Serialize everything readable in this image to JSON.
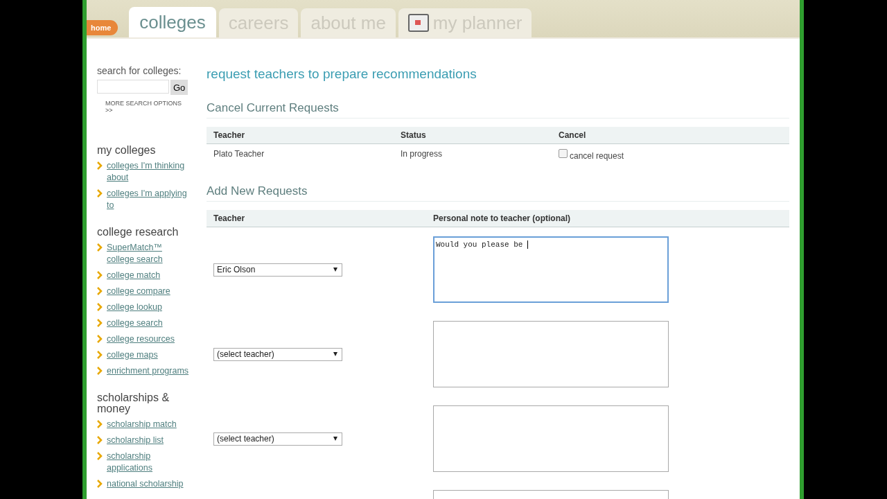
{
  "nav": {
    "home": "home",
    "tabs": [
      {
        "label": "colleges",
        "selected": true,
        "kind": "text"
      },
      {
        "label": "careers",
        "selected": false,
        "kind": "text"
      },
      {
        "label": "about me",
        "selected": false,
        "kind": "text"
      },
      {
        "label": "my planner",
        "selected": false,
        "kind": "planner"
      }
    ]
  },
  "sidebar": {
    "search": {
      "label": "search for colleges:",
      "button": "Go",
      "more": "MORE SEARCH OPTIONS >>"
    },
    "sections": [
      {
        "title": "my colleges",
        "items": [
          "colleges I'm thinking about",
          "colleges I'm applying to"
        ]
      },
      {
        "title": "college research",
        "items": [
          "SuperMatch™ college search",
          "college match",
          "college compare",
          "college lookup",
          "college search",
          "college resources",
          "college maps",
          "enrichment programs"
        ]
      },
      {
        "title": "scholarships & money",
        "items": [
          "scholarship match",
          "scholarship list",
          "scholarship applications",
          "national scholarship"
        ]
      }
    ]
  },
  "page_title": "request teachers to prepare recommendations",
  "cancel_section": {
    "title": "Cancel Current Requests",
    "columns": [
      "Teacher",
      "Status",
      "Cancel"
    ],
    "rows": [
      {
        "teacher": "Plato Teacher",
        "status": "In progress",
        "cancel_label": "cancel request",
        "checked": false
      }
    ]
  },
  "add_section": {
    "title": "Add New Requests",
    "columns": [
      "Teacher",
      "Personal note to teacher (optional)"
    ],
    "rows": [
      {
        "teacher": "Eric Olson",
        "note": "Would you please be ",
        "focused": true
      },
      {
        "teacher": "(select teacher)",
        "note": "",
        "focused": false
      },
      {
        "teacher": "(select teacher)",
        "note": "",
        "focused": false
      },
      {
        "note": "",
        "focused": false
      }
    ]
  }
}
